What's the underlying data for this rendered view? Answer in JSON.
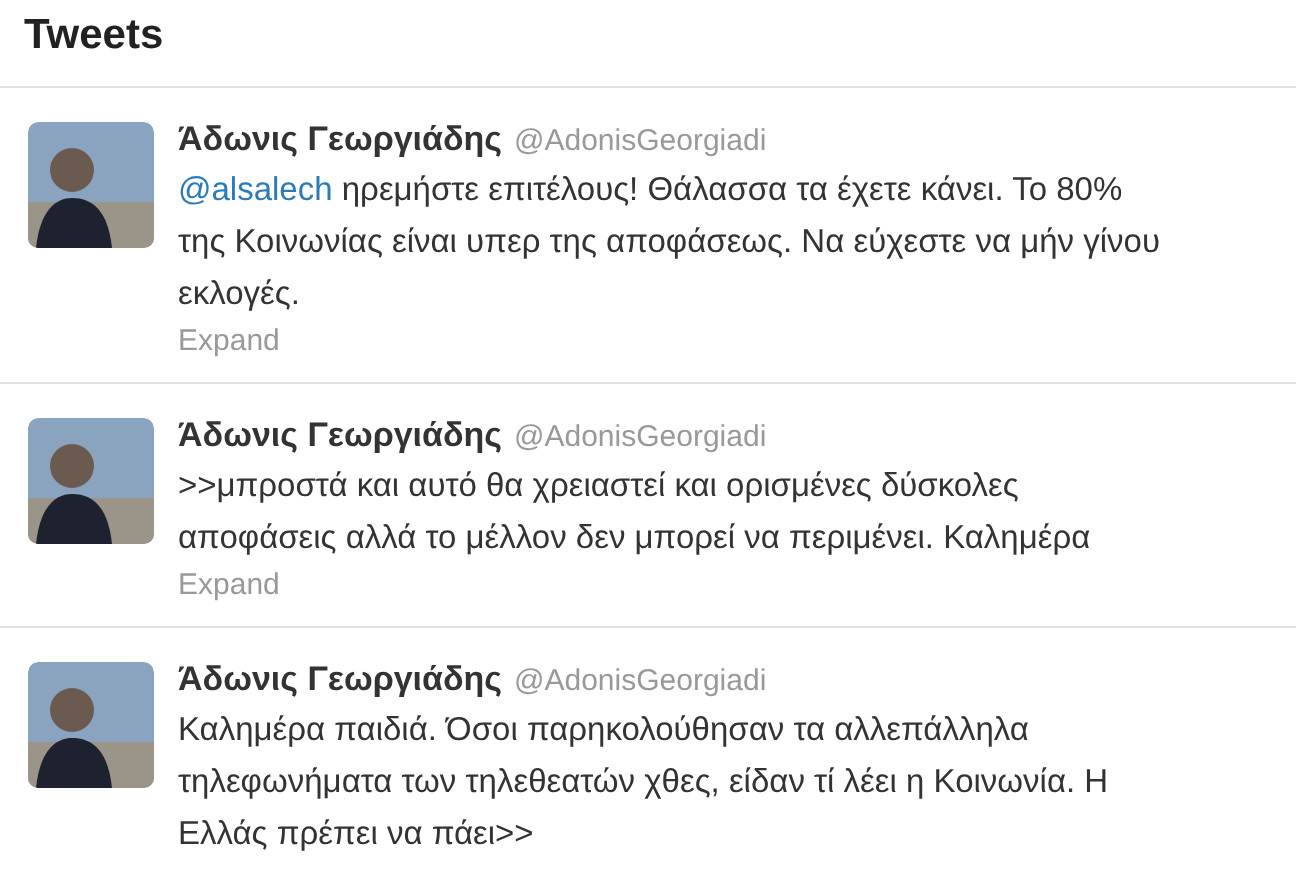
{
  "header": {
    "title": "Tweets"
  },
  "tweets": [
    {
      "name": "Άδωνις Γεωργιάδης",
      "handle": "@AdonisGeorgiadi",
      "mention": "@alsalech",
      "lines": [
        " ηρεμήστε επιτέλους! Θάλασσα τα έχετε κάνει. Το 80%",
        "της Κοινωνίας είναι υπερ της αποφάσεως. Να εύχεστε να μήν γίνου",
        "εκλογές."
      ],
      "expand": "Expand"
    },
    {
      "name": "Άδωνις Γεωργιάδης",
      "handle": "@AdonisGeorgiadi",
      "lines": [
        ">>μπροστά και αυτό θα χρειαστεί και ορισμένες δύσκολες",
        "αποφάσεις αλλά το μέλλον δεν μπορεί να περιμένει. Καλημέρα"
      ],
      "expand": "Expand"
    },
    {
      "name": "Άδωνις Γεωργιάδης",
      "handle": "@AdonisGeorgiadi",
      "lines": [
        "Καλημέρα παιδιά. Όσοι παρηκολούθησαν τα αλλεπάλληλα",
        "τηλεφωνήματα των τηλεθεατών χθες, είδαν τί λέει η Κοινωνία. Η",
        "Ελλάς πρέπει να πάει>>"
      ]
    }
  ]
}
